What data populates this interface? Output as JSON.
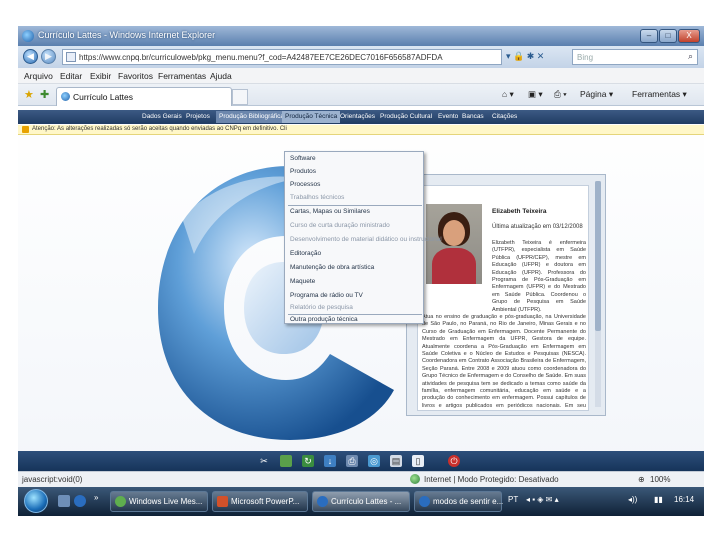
{
  "window": {
    "title": "Currículo Lattes - Windows Internet Explorer",
    "minimize_glyph": "–",
    "maximize_glyph": "□",
    "close_glyph": "X"
  },
  "addressbar": {
    "url": "https://www.cnpq.br/curriculoweb/pkg_menu.menu?f_cod=A42487EE7CE26DEC7016F656587ADFDA",
    "search_placeholder": "Bing",
    "tools_glyphs": "▾ 🔒 ✱ ✕"
  },
  "menubar": {
    "items": [
      "Arquivo",
      "Editar",
      "Exibir",
      "Favoritos",
      "Ferramentas",
      "Ajuda"
    ]
  },
  "favbar": {
    "tab_label": "Currículo Lattes",
    "page_label": "Página ▾",
    "tools_label": "Ferramentas ▾"
  },
  "sitenav": {
    "items": [
      "Dados Gerais",
      "Projetos",
      "Produção Bibliográfica",
      "Produção Técnica",
      "Orientações",
      "Produção Cultural",
      "Evento",
      "Bancas",
      "Citações"
    ]
  },
  "warning": {
    "text": "Atenção: As alterações realizadas só serão aceitas quando enviadas ao CNPq em definitivo. Cli"
  },
  "dropdown": {
    "items": [
      "Software",
      "Produtos",
      "Processos",
      "Trabalhos técnicos",
      "Cartas, Mapas ou Similares",
      "Curso de curta duração ministrado",
      "Desenvolvimento de material didático ou instrucional",
      "Editoração",
      "Manutenção de obra artística",
      "Maquete",
      "Programa de rádio ou TV",
      "Relatório de pesquisa",
      "Outra produção técnica"
    ]
  },
  "profile": {
    "name": "Elizabeth Teixeira",
    "updated": "Última atualização em 03/12/2008",
    "text_short": "Elizabeth Teixeira é enfermeira (UTFPR), especialista em Saúde Pública (UFPR/CEP), mestre em Educação (UFPR) e doutora em Educação (UFPR). Professora do Programa de Pós-Graduação em Enfermagem (UFPR) e do Mestrado em Saúde Pública. Coordenou o Grupo de Pesquisa em Saúde Ambiental (UTFPR).",
    "text_full": "Atua no ensino de graduação e pós-graduação, na Universidade de São Paulo, no Paraná, no Rio de Janeiro, Minas Gerais e no Curso de Graduação em Enfermagem. Docente Permanente do Mestrado em Enfermagem da UFPR, Gestora de equipe. Atualmente coordena a Pós-Graduação em Enfermagem em Saúde Coletiva e o Núcleo de Estudos e Pesquisas (NESCA). Coordenadora em Contrato Associação Brasileira de Enfermagem, Seção Paraná. Entre 2008 e 2009 atuou como coordenadora do Grupo Técnico de Enfermagem e do Conselho de Saúde. Em suas atividades de pesquisa tem se dedicado a temas como saúde da família, enfermagem comunitária, educação em saúde e a produção do conhecimento em enfermagem. Possui capítulos de livros e artigos publicados em periódicos nacionais. Em seu currículo Lattes os termos mais frequentes na contextualização da produção científica são: enfermagem, saúde, educação."
  },
  "statusbar": {
    "left": "javascript:void(0)",
    "zone": "Internet | Modo Protegido: Desativado",
    "zoom": "100%"
  },
  "taskbar": {
    "buttons": [
      "Windows Live Mes...",
      "Microsoft PowerP...",
      "Currículo Lattes - ...",
      "modos de sentir e..."
    ],
    "lang": "PT",
    "time": "16:14"
  },
  "colors": {
    "site_nav": "#2a4870",
    "logo_blue": "#1d6bb8",
    "warning_bg": "#fff7c8"
  }
}
